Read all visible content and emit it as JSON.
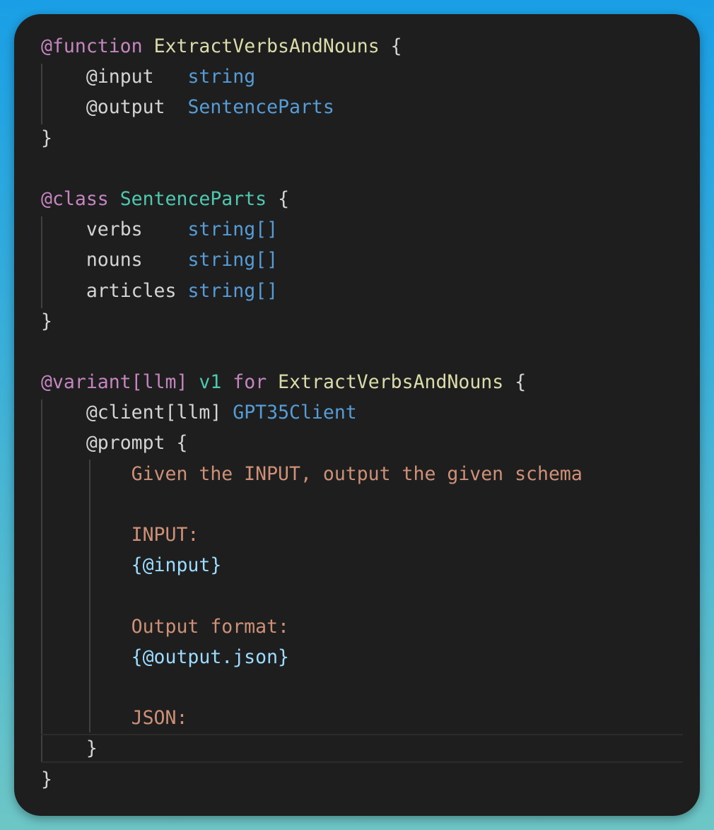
{
  "function_block": {
    "decorator": "@function",
    "name": "ExtractVerbsAndNouns",
    "open_brace": "{",
    "input_kw": "@input",
    "input_type": "string",
    "output_kw": "@output",
    "output_type": "SentenceParts",
    "close_brace": "}"
  },
  "class_block": {
    "decorator": "@class",
    "name": "SentenceParts",
    "open_brace": "{",
    "fields": [
      {
        "name": "verbs",
        "type": "string[]"
      },
      {
        "name": "nouns",
        "type": "string[]"
      },
      {
        "name": "articles",
        "type": "string[]"
      }
    ],
    "close_brace": "}"
  },
  "variant_block": {
    "decorator": "@variant[llm]",
    "version": "v1",
    "for_kw": "for",
    "target": "ExtractVerbsAndNouns",
    "open_brace": "{",
    "client_kw": "@client[llm]",
    "client_name": "GPT35Client",
    "prompt_kw": "@prompt",
    "prompt_open": "{",
    "prompt_lines": {
      "line1": "Given the INPUT, output the given schema",
      "line2": "INPUT:",
      "line3": "{@input}",
      "line4": "Output format:",
      "line5": "{@output.json}",
      "line6": "JSON:"
    },
    "prompt_close": "}",
    "close_brace": "}"
  }
}
